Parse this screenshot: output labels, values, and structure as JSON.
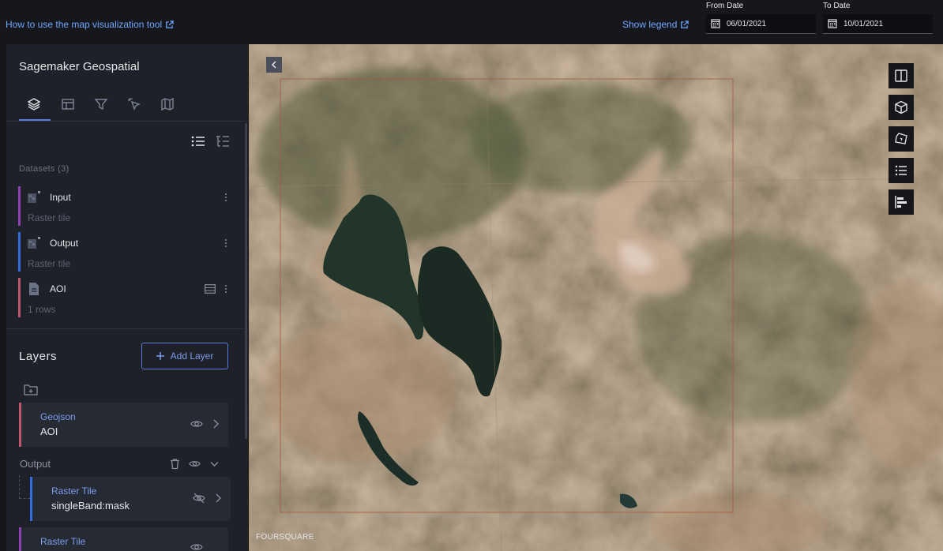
{
  "topbar": {
    "help_link": "How to use the map visualization tool",
    "legend_link": "Show legend",
    "from_label": "From Date",
    "from_value": "06/01/2021",
    "to_label": "To Date",
    "to_value": "10/01/2021"
  },
  "sidebar": {
    "title": "Sagemaker Geospatial",
    "tabs": [
      "layers-icon",
      "interactions-icon",
      "filters-icon",
      "interaction-cursor-icon",
      "basemap-icon"
    ],
    "datasets_header": "Datasets (3)",
    "datasets": [
      {
        "name": "Input",
        "sub": "Raster tile",
        "color": "#8e3fb3",
        "icon": "raster-tile-icon"
      },
      {
        "name": "Output",
        "sub": "Raster tile",
        "color": "#2f6de0",
        "icon": "raster-tile-icon"
      },
      {
        "name": "AOI",
        "sub": "1 rows",
        "color": "#c2566e",
        "icon": "file-icon"
      }
    ],
    "layers_title": "Layers",
    "add_layer_label": "Add Layer",
    "layers": [
      {
        "type": "Geojson",
        "name": "AOI",
        "color": "#c2566e"
      }
    ],
    "group_name": "Output",
    "group_layers": [
      {
        "type": "Raster Tile",
        "name": "singleBand:mask",
        "color": "#2f6de0"
      },
      {
        "type": "Raster Tile",
        "name": "",
        "color": "#8e3fb3"
      }
    ]
  },
  "map": {
    "attribution": "FOURSQUARE",
    "tools": [
      "split-map-icon",
      "3d-view-icon",
      "draw-polygon-icon",
      "legend-icon",
      "timeline-icon"
    ]
  },
  "colors": {
    "accent": "#5a7bd8",
    "link": "#6fa8ff",
    "panel": "#1e2128"
  }
}
